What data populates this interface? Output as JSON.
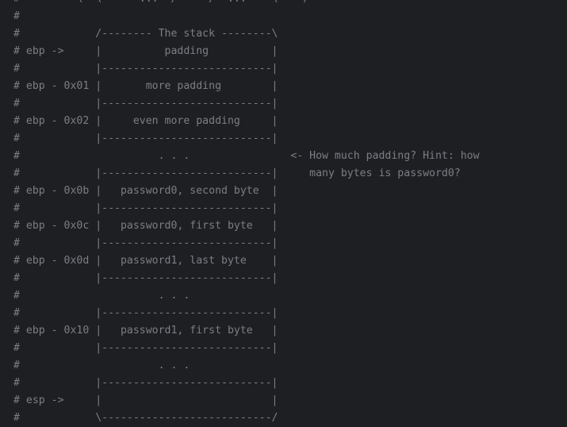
{
  "editor": {
    "background": "#1e1f22",
    "comment_color": "#7a7e85",
    "lines": [
      "#         \\  \\      ...  /     /  ...    \\    /",
      "#",
      "#            /-------- The stack --------\\",
      "# ebp ->     |          padding          |",
      "#            |---------------------------|",
      "# ebp - 0x01 |       more padding        |",
      "#            |---------------------------|",
      "# ebp - 0x02 |     even more padding     |",
      "#            |---------------------------|",
      "#                      . . .                <- How much padding? Hint: how",
      "#            |---------------------------|     many bytes is password0?",
      "# ebp - 0x0b |   password0, second byte  |",
      "#            |---------------------------|",
      "# ebp - 0x0c |   password0, first byte   |",
      "#            |---------------------------|",
      "# ebp - 0x0d |   password1, last byte    |",
      "#            |---------------------------|",
      "#                      . . .",
      "#            |---------------------------|",
      "# ebp - 0x10 |   password1, first byte   |",
      "#            |---------------------------|",
      "#                      . . .",
      "#            |---------------------------|",
      "# esp ->     |                           |",
      "#            \\---------------------------/"
    ]
  }
}
